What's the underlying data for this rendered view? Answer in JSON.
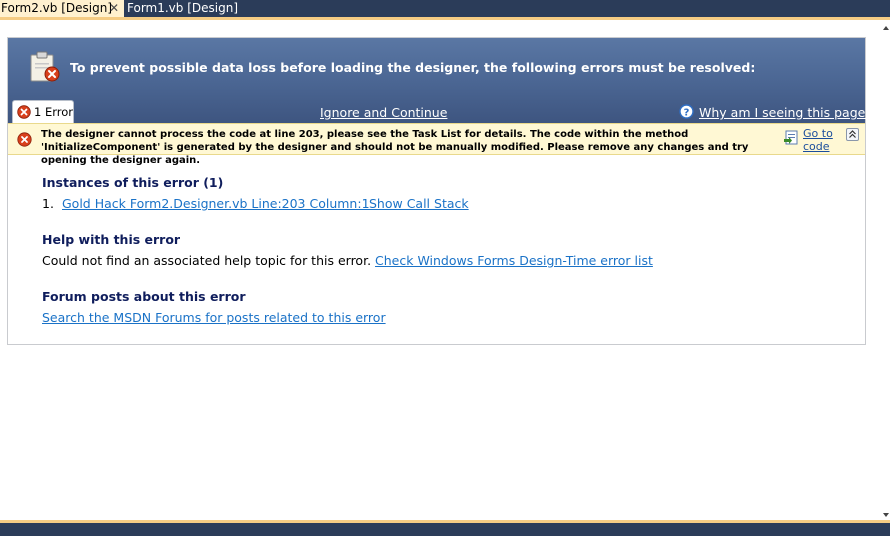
{
  "tabs": [
    {
      "label": "Form2.vb [Design]",
      "active": true
    },
    {
      "label": "Form1.vb [Design]",
      "active": false
    }
  ],
  "close_glyph": "✕",
  "banner": {
    "title": "To prevent possible data loss before loading the designer, the following errors must be resolved:",
    "icon": "clipboard-error-icon"
  },
  "error_tab": {
    "label": "1 Error"
  },
  "actions": {
    "ignore": "Ignore and Continue",
    "why": "Why am I seeing this page?"
  },
  "message": {
    "text": "The designer cannot process the code at line 203, please see the Task List for details. The code within the method 'InitializeComponent' is generated by the designer and should not be manually modified. Please remove any changes and try opening the designer again.",
    "goto": "Go to code"
  },
  "instances": {
    "heading": "Instances of this error (1)",
    "items": [
      {
        "num": "1.",
        "location": "Gold Hack Form2.Designer.vb Line:203 Column:1",
        "call_stack": "Show Call Stack"
      }
    ]
  },
  "help": {
    "heading": "Help with this error",
    "text": "Could not find an associated help topic for this error.",
    "link": "Check Windows Forms Design-Time error list"
  },
  "forum": {
    "heading": "Forum posts about this error",
    "link": "Search the MSDN Forums for posts related to this error"
  },
  "colors": {
    "banner": "#4a6592",
    "message_bg": "#fff8d4",
    "link": "#1a72c7",
    "heading": "#0f1d5c",
    "tabstrip": "#2b3c59",
    "tab_active": "#fff1cf"
  }
}
